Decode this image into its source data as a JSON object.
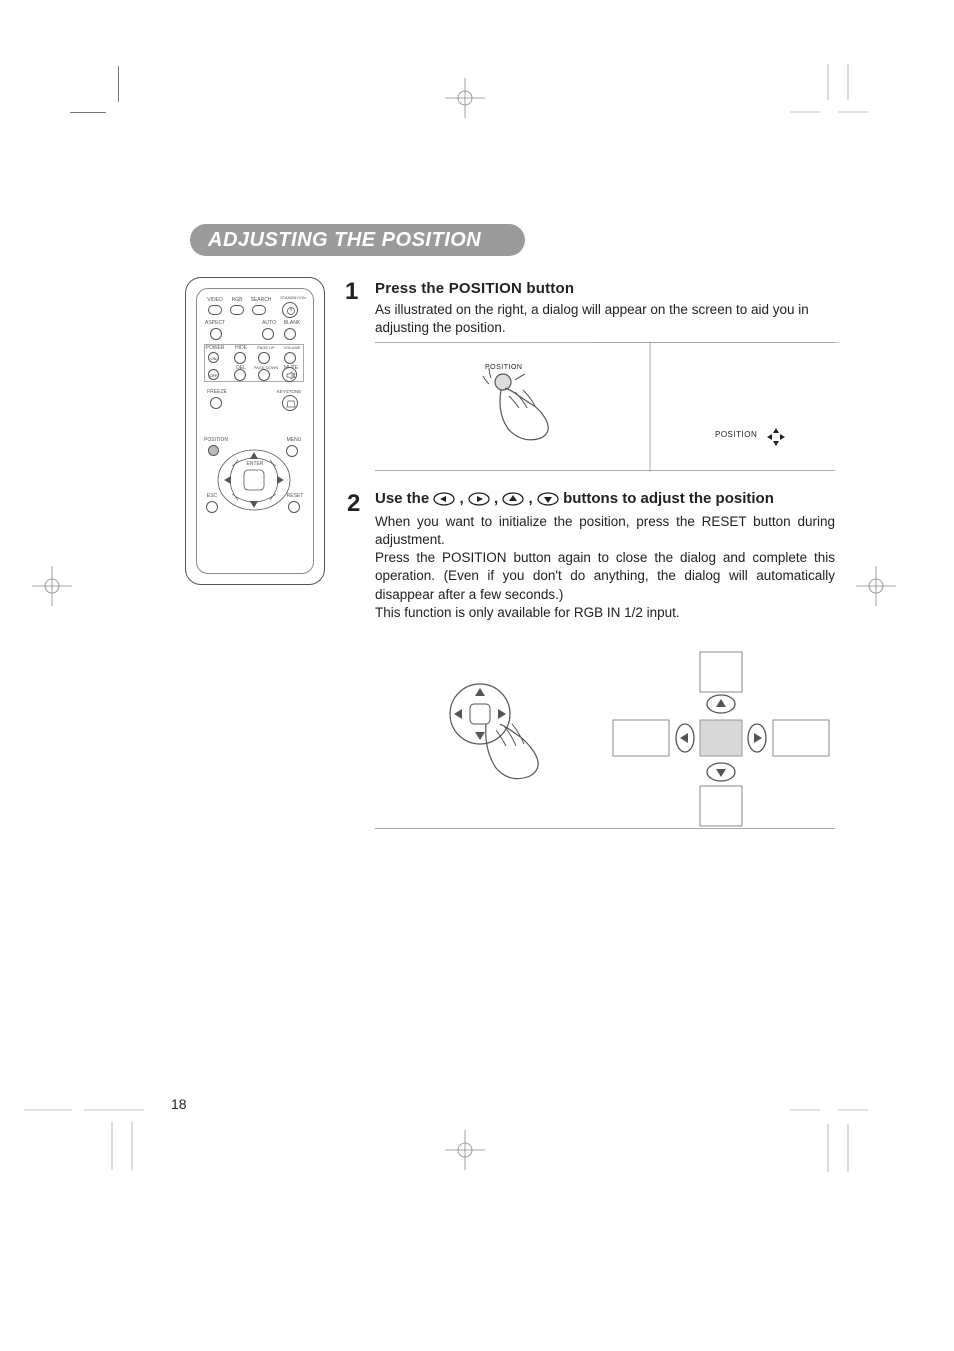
{
  "title": "ADJUSTING THE POSITION",
  "page_number": "18",
  "remote": {
    "row1": [
      "VIDEO",
      "RGB",
      "SEARCH",
      "STANDBY/ON"
    ],
    "row2": [
      "ASPECT",
      "",
      "AUTO",
      "BLANK"
    ],
    "row3": [
      "POWER",
      "HIDE",
      "PAGE UP",
      "VOLUME"
    ],
    "row3b": [
      "ON"
    ],
    "row4": [
      "",
      "DEL",
      "PAGE DOWN",
      "MUTE"
    ],
    "row4b": [
      "OFF"
    ],
    "row5": [
      "FREEZE",
      "",
      "",
      "KEYSTONE"
    ],
    "lower": [
      "POSITION",
      "MENU",
      "ENTER",
      "ESC",
      "RESET"
    ]
  },
  "step1": {
    "num": "1",
    "head": "Press the POSITION button",
    "body": "As illustrated on the right, a dialog will appear on the screen to aid you in adjusting the position."
  },
  "illus1": {
    "label": "POSITION"
  },
  "screen": {
    "label": "POSITION"
  },
  "step2": {
    "num": "2",
    "head_pre": "Use the ",
    "head_mid_sep": " , ",
    "head_post": " buttons to adjust the position",
    "body1": "When you want to initialize the position, press the RESET button during adjustment.",
    "body2": "Press the POSITION button again to close the dialog and complete this operation.  (Even if you don't do anything, the dialog will automatically disappear after a few seconds.)",
    "body3": "This function is only available for RGB IN 1/2 input."
  }
}
